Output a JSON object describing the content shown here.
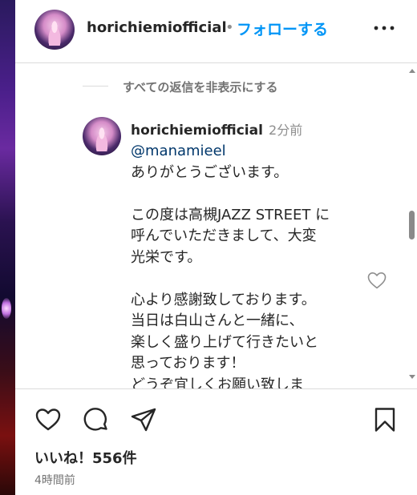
{
  "header": {
    "username": "horichiemiofficial",
    "separator": "•",
    "follow_label": "フォローする",
    "more_icon": "more-options-icon"
  },
  "comments": {
    "hide_replies_label": "すべての返信を非表示にする",
    "reply": {
      "username": "horichiemiofficial",
      "time": "2分前",
      "mention": "@manamieel",
      "lines": [
        "ありがとうございます。",
        "",
        "この度は高槻JAZZ STREET に",
        "呼んでいただきまして、大変",
        "光栄です。",
        "",
        "心より感謝致しております。",
        "当日は白山さんと一緒に、",
        "楽しく盛り上げて行きたいと",
        "思っております！",
        "どうぞ宜しくお願い致しま"
      ]
    }
  },
  "actions": {
    "like_icon": "heart-icon",
    "comment_icon": "comment-icon",
    "share_icon": "paper-plane-icon",
    "save_icon": "bookmark-icon"
  },
  "footer": {
    "likes": "いいね！556件",
    "posted_time": "4時間前"
  },
  "colors": {
    "accent": "#0095f6",
    "mention": "#00376b",
    "muted": "#8e8e8e"
  }
}
